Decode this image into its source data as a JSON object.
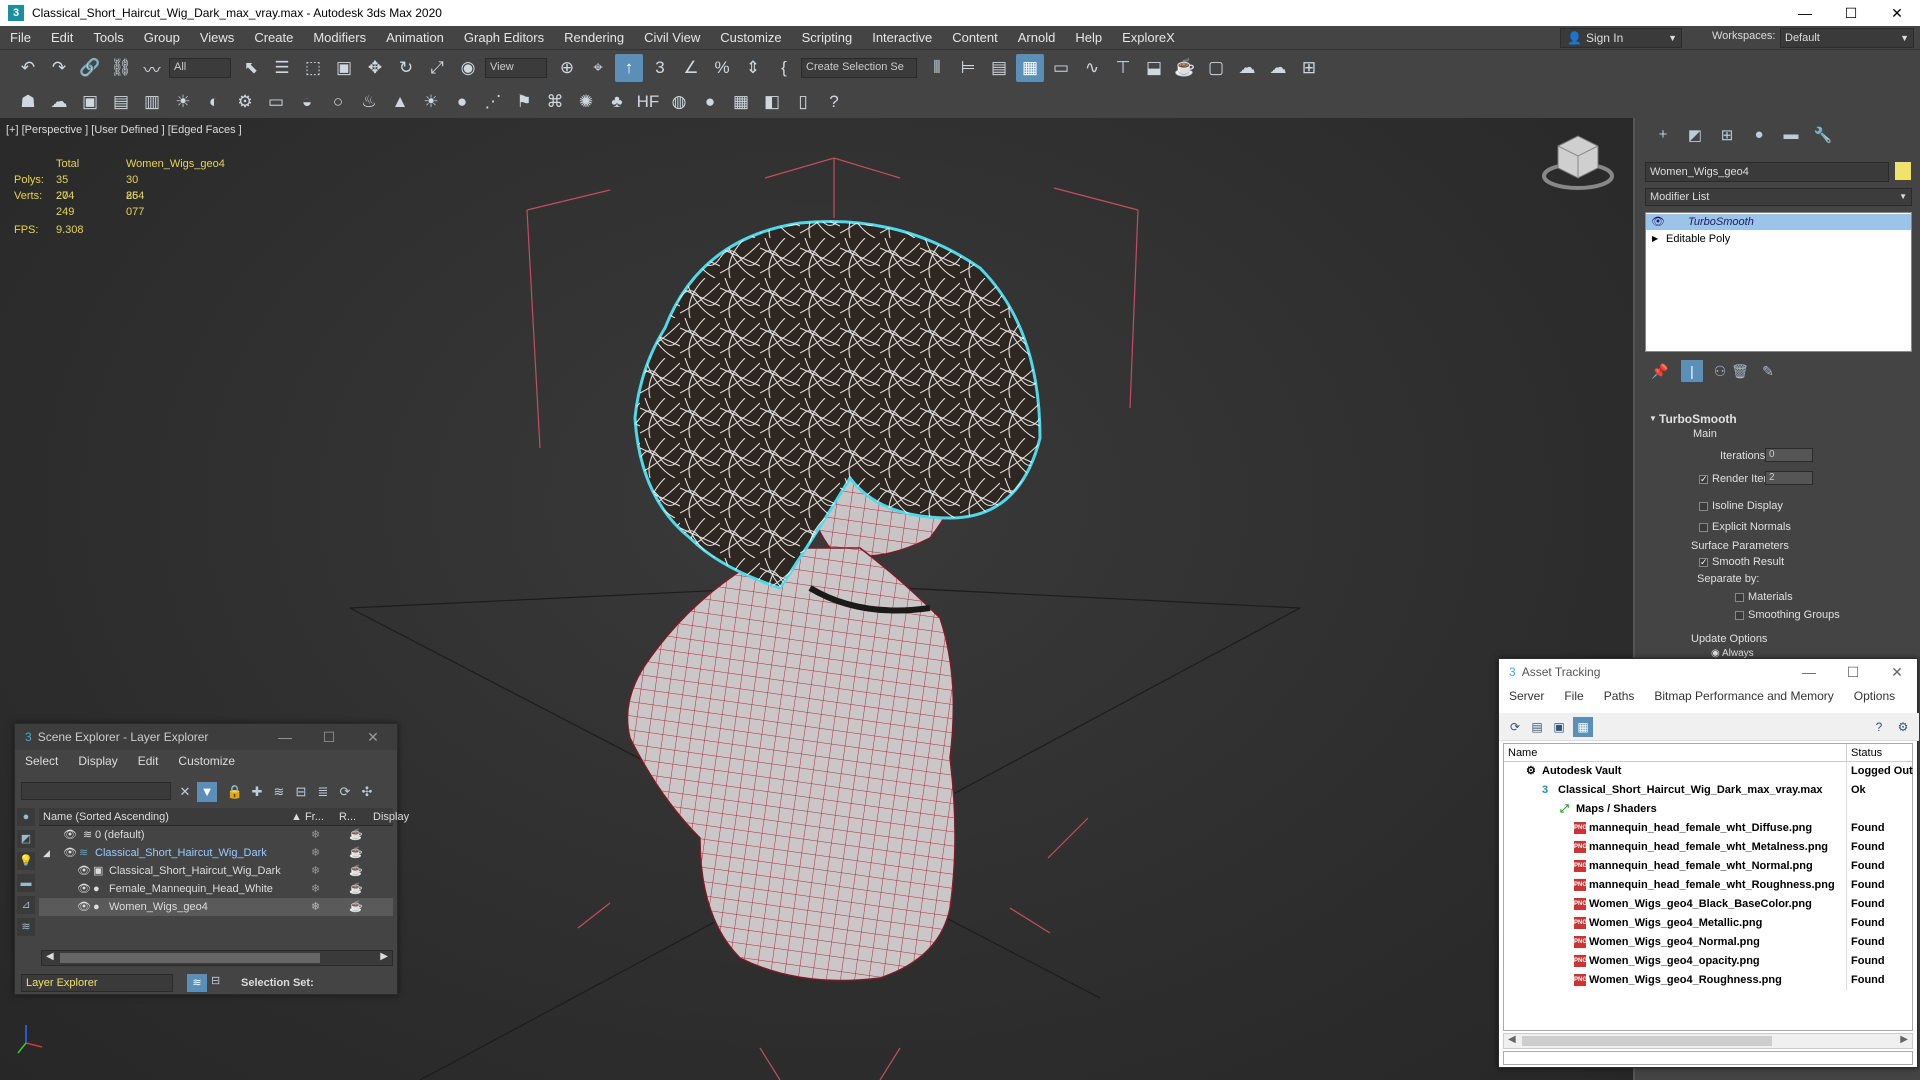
{
  "window": {
    "title": "Classical_Short_Haircut_Wig_Dark_max_vray.max - Autodesk 3ds Max 2020",
    "app_icon": "3",
    "minimize": "—",
    "maximize": "☐",
    "close": "✕"
  },
  "menu": [
    "File",
    "Edit",
    "Tools",
    "Group",
    "Views",
    "Create",
    "Modifiers",
    "Animation",
    "Graph Editors",
    "Rendering",
    "Civil View",
    "Customize",
    "Scripting",
    "Interactive",
    "Content",
    "Arnold",
    "Help",
    "ExploreX"
  ],
  "account": {
    "sign_in": "Sign In",
    "workspaces_label": "Workspaces:",
    "workspace": "Default"
  },
  "toolbar": {
    "selection_filter": "All",
    "ref_coord": "View",
    "named_selection": "Create Selection Se"
  },
  "viewport": {
    "label": "[+] [Perspective ] [User Defined ] [Edged Faces ]",
    "stats": {
      "total_label": "Total",
      "object_label": "Women_Wigs_geo4",
      "polys_label": "Polys:",
      "polys_total": "35 204",
      "polys_obj": "30 864",
      "verts_label": "Verts:",
      "verts_total": "27 249",
      "verts_obj": "25 077",
      "fps_label": "FPS:",
      "fps": "9.308"
    }
  },
  "command_panel": {
    "object_name": "Women_Wigs_geo4",
    "object_color": "#f2e16a",
    "modifier_list": "Modifier List",
    "stack": [
      "TurboSmooth",
      "Editable Poly"
    ],
    "rollout": {
      "title": "TurboSmooth",
      "main": "Main",
      "iterations_label": "Iterations:",
      "iterations": "0",
      "render_iters_label": "Render Iters:",
      "render_iters": "2",
      "isoline": "Isoline Display",
      "explicit_normals": "Explicit Normals",
      "surface_params": "Surface Parameters",
      "smooth_result": "Smooth Result",
      "separate_by": "Separate by:",
      "materials": "Materials",
      "smoothing_groups": "Smoothing Groups",
      "update_options": "Update Options",
      "always": "Always"
    }
  },
  "scene_explorer": {
    "title": "Scene Explorer - Layer Explorer",
    "menu": [
      "Select",
      "Display",
      "Edit",
      "Customize"
    ],
    "col_name": "Name (Sorted Ascending)",
    "col_fr": "▲ Fr...",
    "col_r": "R...",
    "col_display": "Display",
    "rows": [
      {
        "name": "0 (default)",
        "indent": 1,
        "selected": false
      },
      {
        "name": "Classical_Short_Haircut_Wig_Dark",
        "indent": 1,
        "selected": false,
        "highlight": true
      },
      {
        "name": "Classical_Short_Haircut_Wig_Dark",
        "indent": 2,
        "selected": false
      },
      {
        "name": "Female_Mannequin_Head_White",
        "indent": 2,
        "selected": false
      },
      {
        "name": "Women_Wigs_geo4",
        "indent": 2,
        "selected": true
      }
    ],
    "explorer_type": "Layer Explorer",
    "selection_set": "Selection Set:"
  },
  "asset_tracking": {
    "title": "Asset Tracking",
    "menu": [
      "Server",
      "File",
      "Paths",
      "Bitmap Performance and Memory",
      "Options"
    ],
    "col_name": "Name",
    "col_status": "Status",
    "rows": [
      {
        "name": "Autodesk Vault",
        "status": "Logged Out",
        "indent": 1,
        "icon": "vault"
      },
      {
        "name": "Classical_Short_Haircut_Wig_Dark_max_vray.max",
        "status": "Ok",
        "indent": 2,
        "icon": "max"
      },
      {
        "name": "Maps / Shaders",
        "status": "",
        "indent": 3,
        "icon": "maps"
      },
      {
        "name": "mannequin_head_female_wht_Diffuse.png",
        "status": "Found",
        "indent": 4,
        "icon": "png"
      },
      {
        "name": "mannequin_head_female_wht_Metalness.png",
        "status": "Found",
        "indent": 4,
        "icon": "png"
      },
      {
        "name": "mannequin_head_female_wht_Normal.png",
        "status": "Found",
        "indent": 4,
        "icon": "png"
      },
      {
        "name": "mannequin_head_female_wht_Roughness.png",
        "status": "Found",
        "indent": 4,
        "icon": "png"
      },
      {
        "name": "Women_Wigs_geo4_Black_BaseColor.png",
        "status": "Found",
        "indent": 4,
        "icon": "png"
      },
      {
        "name": "Women_Wigs_geo4_Metallic.png",
        "status": "Found",
        "indent": 4,
        "icon": "png"
      },
      {
        "name": "Women_Wigs_geo4_Normal.png",
        "status": "Found",
        "indent": 4,
        "icon": "png"
      },
      {
        "name": "Women_Wigs_geo4_opacity.png",
        "status": "Found",
        "indent": 4,
        "icon": "png"
      },
      {
        "name": "Women_Wigs_geo4_Roughness.png",
        "status": "Found",
        "indent": 4,
        "icon": "png"
      }
    ]
  },
  "colors": {
    "accent": "#5b8fb8",
    "selection_outline": "#4fd8e8",
    "grid_lines": "#b84a5a",
    "stats_text": "#e8d44d"
  }
}
